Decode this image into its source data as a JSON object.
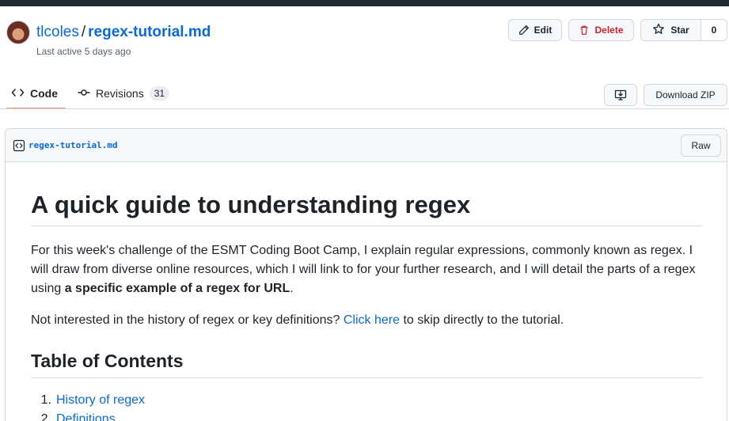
{
  "header": {
    "owner": "tlcoles",
    "separator": "/",
    "gist_name": "regex-tutorial.md",
    "last_active": "Last active 5 days ago"
  },
  "actions": {
    "edit_label": "Edit",
    "delete_label": "Delete",
    "star_label": "Star",
    "star_count": "0"
  },
  "tabs": {
    "code_label": "Code",
    "revisions_label": "Revisions",
    "revisions_count": "31",
    "download_label": "Download ZIP"
  },
  "file": {
    "name": "regex-tutorial.md",
    "raw_label": "Raw"
  },
  "markdown": {
    "h1": "A quick guide to understanding regex",
    "p1_text": "For this week's challenge of the ESMT Coding Boot Camp, I explain regular expressions, commonly known as regex. I will draw from diverse online resources, which I will link to for your further research, and I will detail the parts of a regex using ",
    "p1_bold": "a specific example of a regex for URL",
    "p1_end": ".",
    "p2_before": "Not interested in the history of regex or key definitions? ",
    "p2_link": "Click here",
    "p2_after": " to skip directly to the tutorial.",
    "h2": "Table of Contents",
    "toc": [
      {
        "num": "1.",
        "label": "History of regex"
      },
      {
        "num": "2.",
        "label": "Definitions"
      }
    ]
  },
  "colors": {
    "link": "#0969da",
    "danger": "#cf222e",
    "tab_underline": "#fd8c73",
    "topbar": "#24292f"
  }
}
